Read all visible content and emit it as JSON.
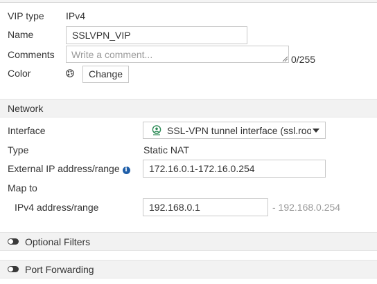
{
  "general": {
    "vip_type_label": "VIP type",
    "vip_type_value": "IPv4",
    "name_label": "Name",
    "name_value": "SSLVPN_VIP",
    "comments_label": "Comments",
    "comments_placeholder": "Write a comment...",
    "comments_counter": "0/255",
    "color_label": "Color",
    "color_icon": "palette-icon",
    "change_button": "Change"
  },
  "network": {
    "section_title": "Network",
    "interface_label": "Interface",
    "interface_value": "SSL-VPN tunnel interface (ssl.roo",
    "interface_icon": "tunnel-interface-icon",
    "type_label": "Type",
    "type_value": "Static NAT",
    "external_ip_label": "External IP address/range",
    "external_ip_value": "172.16.0.1-172.16.0.254",
    "map_to_label": "Map to",
    "ipv4_range_label": "IPv4 address/range",
    "ipv4_range_value": "192.168.0.1",
    "ipv4_range_end": "- 192.168.0.254"
  },
  "sections": {
    "optional_filters": "Optional Filters",
    "port_forwarding": "Port Forwarding"
  },
  "colors": {
    "info_icon": "#1f5ea8",
    "interface_icon": "#2e8b57",
    "section_bg": "#f2f2f2"
  }
}
